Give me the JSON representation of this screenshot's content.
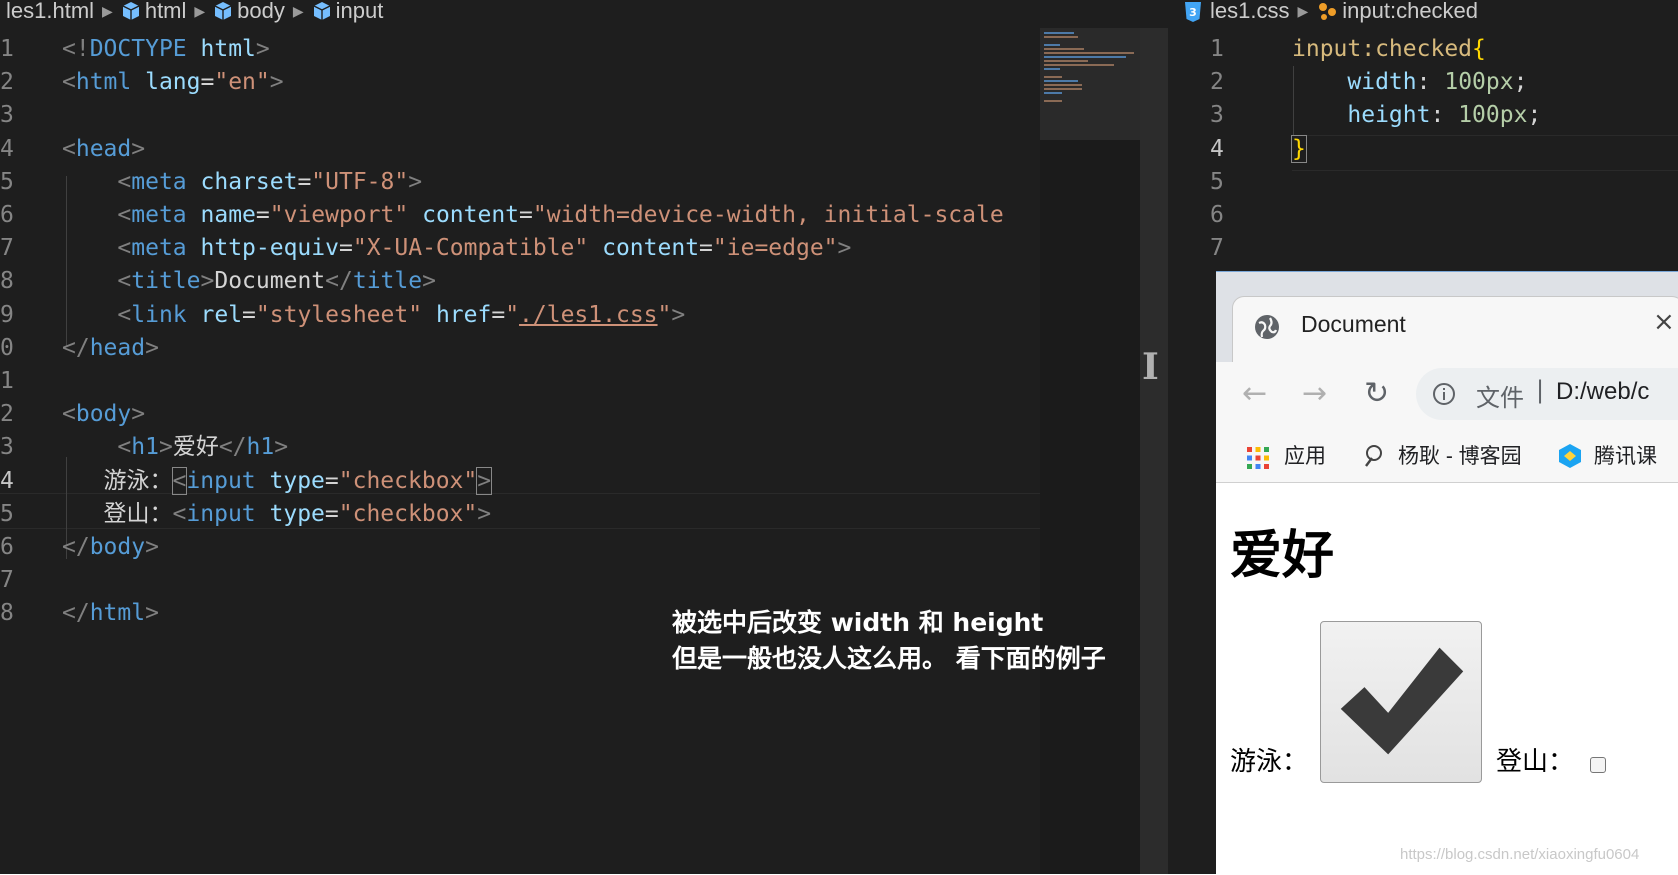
{
  "left_editor": {
    "breadcrumb": [
      "les1.html",
      "html",
      "body",
      "input"
    ],
    "lines": [
      {
        "n": "1",
        "tokens": [
          {
            "t": "<!",
            "c": "bracket"
          },
          {
            "t": "DOCTYPE",
            "c": "tag"
          },
          {
            "t": " ",
            "c": "text"
          },
          {
            "t": "html",
            "c": "attr"
          },
          {
            "t": ">",
            "c": "bracket"
          }
        ]
      },
      {
        "n": "2",
        "tokens": [
          {
            "t": "<",
            "c": "bracket"
          },
          {
            "t": "html",
            "c": "tag"
          },
          {
            "t": " ",
            "c": "text"
          },
          {
            "t": "lang",
            "c": "attr"
          },
          {
            "t": "=",
            "c": "text"
          },
          {
            "t": "\"en\"",
            "c": "str"
          },
          {
            "t": ">",
            "c": "bracket"
          }
        ]
      },
      {
        "n": "3",
        "tokens": []
      },
      {
        "n": "4",
        "tokens": [
          {
            "t": "<",
            "c": "bracket"
          },
          {
            "t": "head",
            "c": "tag"
          },
          {
            "t": ">",
            "c": "bracket"
          }
        ]
      },
      {
        "n": "5",
        "tokens": [
          {
            "t": "    ",
            "c": "text"
          },
          {
            "t": "<",
            "c": "bracket"
          },
          {
            "t": "meta",
            "c": "tag"
          },
          {
            "t": " ",
            "c": "text"
          },
          {
            "t": "charset",
            "c": "attr"
          },
          {
            "t": "=",
            "c": "text"
          },
          {
            "t": "\"UTF-8\"",
            "c": "str"
          },
          {
            "t": ">",
            "c": "bracket"
          }
        ]
      },
      {
        "n": "6",
        "tokens": [
          {
            "t": "    ",
            "c": "text"
          },
          {
            "t": "<",
            "c": "bracket"
          },
          {
            "t": "meta",
            "c": "tag"
          },
          {
            "t": " ",
            "c": "text"
          },
          {
            "t": "name",
            "c": "attr"
          },
          {
            "t": "=",
            "c": "text"
          },
          {
            "t": "\"viewport\"",
            "c": "str"
          },
          {
            "t": " ",
            "c": "text"
          },
          {
            "t": "content",
            "c": "attr"
          },
          {
            "t": "=",
            "c": "text"
          },
          {
            "t": "\"width=device-width, initial-scale",
            "c": "str"
          }
        ]
      },
      {
        "n": "7",
        "tokens": [
          {
            "t": "    ",
            "c": "text"
          },
          {
            "t": "<",
            "c": "bracket"
          },
          {
            "t": "meta",
            "c": "tag"
          },
          {
            "t": " ",
            "c": "text"
          },
          {
            "t": "http-equiv",
            "c": "attr"
          },
          {
            "t": "=",
            "c": "text"
          },
          {
            "t": "\"X-UA-Compatible\"",
            "c": "str"
          },
          {
            "t": " ",
            "c": "text"
          },
          {
            "t": "content",
            "c": "attr"
          },
          {
            "t": "=",
            "c": "text"
          },
          {
            "t": "\"ie=edge\"",
            "c": "str"
          },
          {
            "t": ">",
            "c": "bracket"
          }
        ]
      },
      {
        "n": "8",
        "tokens": [
          {
            "t": "    ",
            "c": "text"
          },
          {
            "t": "<",
            "c": "bracket"
          },
          {
            "t": "title",
            "c": "tag"
          },
          {
            "t": ">",
            "c": "bracket"
          },
          {
            "t": "Document",
            "c": "text"
          },
          {
            "t": "</",
            "c": "bracket"
          },
          {
            "t": "title",
            "c": "tag"
          },
          {
            "t": ">",
            "c": "bracket"
          }
        ]
      },
      {
        "n": "9",
        "tokens": [
          {
            "t": "    ",
            "c": "text"
          },
          {
            "t": "<",
            "c": "bracket"
          },
          {
            "t": "link",
            "c": "tag"
          },
          {
            "t": " ",
            "c": "text"
          },
          {
            "t": "rel",
            "c": "attr"
          },
          {
            "t": "=",
            "c": "text"
          },
          {
            "t": "\"stylesheet\"",
            "c": "str"
          },
          {
            "t": " ",
            "c": "text"
          },
          {
            "t": "href",
            "c": "attr"
          },
          {
            "t": "=",
            "c": "text"
          },
          {
            "t": "\"",
            "c": "str"
          },
          {
            "t": "./les1.css",
            "c": "str link"
          },
          {
            "t": "\"",
            "c": "str"
          },
          {
            "t": ">",
            "c": "bracket"
          }
        ]
      },
      {
        "n": "0",
        "tokens": [
          {
            "t": "</",
            "c": "bracket"
          },
          {
            "t": "head",
            "c": "tag"
          },
          {
            "t": ">",
            "c": "bracket"
          }
        ]
      },
      {
        "n": "1",
        "tokens": []
      },
      {
        "n": "2",
        "tokens": [
          {
            "t": "<",
            "c": "bracket"
          },
          {
            "t": "body",
            "c": "tag"
          },
          {
            "t": ">",
            "c": "bracket"
          }
        ]
      },
      {
        "n": "3",
        "tokens": [
          {
            "t": "    ",
            "c": "text"
          },
          {
            "t": "<",
            "c": "bracket"
          },
          {
            "t": "h1",
            "c": "tag"
          },
          {
            "t": ">",
            "c": "bracket"
          },
          {
            "t": "爱好",
            "c": "text"
          },
          {
            "t": "</",
            "c": "bracket"
          },
          {
            "t": "h1",
            "c": "tag"
          },
          {
            "t": ">",
            "c": "bracket"
          }
        ]
      },
      {
        "n": "4",
        "active": true,
        "tokens": [
          {
            "t": "   游泳：",
            "c": "text"
          },
          {
            "t": "<",
            "c": "bracket box"
          },
          {
            "t": "input",
            "c": "tag"
          },
          {
            "t": " ",
            "c": "text"
          },
          {
            "t": "type",
            "c": "attr"
          },
          {
            "t": "=",
            "c": "text"
          },
          {
            "t": "\"checkbox\"",
            "c": "str"
          },
          {
            "t": ">",
            "c": "bracket box"
          }
        ]
      },
      {
        "n": "5",
        "tokens": [
          {
            "t": "   登山：",
            "c": "text"
          },
          {
            "t": "<",
            "c": "bracket"
          },
          {
            "t": "input",
            "c": "tag"
          },
          {
            "t": " ",
            "c": "text"
          },
          {
            "t": "type",
            "c": "attr"
          },
          {
            "t": "=",
            "c": "text"
          },
          {
            "t": "\"checkbox\"",
            "c": "str"
          },
          {
            "t": ">",
            "c": "bracket"
          }
        ]
      },
      {
        "n": "6",
        "tokens": [
          {
            "t": "</",
            "c": "bracket"
          },
          {
            "t": "body",
            "c": "tag"
          },
          {
            "t": ">",
            "c": "bracket"
          }
        ]
      },
      {
        "n": "7",
        "tokens": []
      },
      {
        "n": "8",
        "tokens": [
          {
            "t": "</",
            "c": "bracket"
          },
          {
            "t": "html",
            "c": "tag"
          },
          {
            "t": ">",
            "c": "bracket"
          }
        ]
      }
    ]
  },
  "annotation": {
    "line1": "被选中后改变 width 和 height",
    "line2": "但是一般也没人这么用。 看下面的例子"
  },
  "right_editor": {
    "breadcrumb_file": "les1.css",
    "breadcrumb_symbol": "input:checked",
    "lines": [
      {
        "n": "1",
        "tokens": [
          {
            "t": "input:checked",
            "c": "sel"
          },
          {
            "t": "{",
            "c": "brace"
          }
        ]
      },
      {
        "n": "2",
        "tokens": [
          {
            "t": "    ",
            "c": "punct"
          },
          {
            "t": "width",
            "c": "prop"
          },
          {
            "t": ": ",
            "c": "punct"
          },
          {
            "t": "100px",
            "c": "num"
          },
          {
            "t": ";",
            "c": "punct"
          }
        ]
      },
      {
        "n": "3",
        "tokens": [
          {
            "t": "    ",
            "c": "punct"
          },
          {
            "t": "height",
            "c": "prop"
          },
          {
            "t": ": ",
            "c": "punct"
          },
          {
            "t": "100px",
            "c": "num"
          },
          {
            "t": ";",
            "c": "punct"
          }
        ]
      },
      {
        "n": "4",
        "active": true,
        "tokens": [
          {
            "t": "}",
            "c": "brace box"
          }
        ]
      },
      {
        "n": "5",
        "tokens": []
      },
      {
        "n": "6",
        "tokens": []
      },
      {
        "n": "7",
        "tokens": []
      }
    ]
  },
  "browser": {
    "tab_title": "Document",
    "tab_close": "×",
    "url_file_label": "文件",
    "url_separator": "|",
    "url_path": "D:/web/c",
    "bookmarks": [
      "应用",
      "杨耿 - 博客园",
      "腾讯课"
    ],
    "page": {
      "h1": "爱好",
      "swim_label": "游泳：",
      "climb_label": "登山：",
      "swim_checked": true,
      "climb_checked": false
    }
  },
  "watermark": "https://blog.csdn.net/xiaoxingfu0604",
  "colors": {
    "editor_bg": "#1e1e1e",
    "tag": "#569cd6",
    "attr": "#9cdcfe",
    "string": "#ce9178",
    "selector": "#d7ba7d",
    "number": "#b5cea8",
    "brace": "#ffd700"
  },
  "icons": {
    "breadcrumb_node": "cube-icon",
    "css_file": "css3-icon",
    "symbol": "symbol-class-icon",
    "tab_favicon": "globe-icon",
    "back": "arrow-left-icon",
    "forward": "arrow-right-icon",
    "reload": "reload-icon",
    "site_info": "info-icon",
    "apps": "apps-grid-icon"
  }
}
